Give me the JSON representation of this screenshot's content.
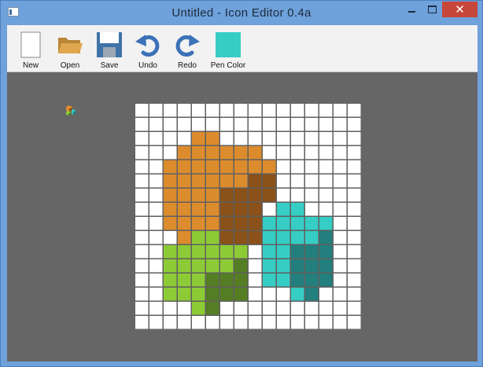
{
  "window": {
    "title": "Untitled - Icon Editor 0.4a"
  },
  "toolbar": {
    "new_label": "New",
    "open_label": "Open",
    "save_label": "Save",
    "undo_label": "Undo",
    "redo_label": "Redo",
    "pen_color_label": "Pen Color",
    "pen_color": "#36cdc4"
  },
  "caption_buttons": {
    "close_glyph": "✕"
  },
  "icons": [
    "app-icon",
    "new-file-icon",
    "folder-icon",
    "floppy-disk-icon",
    "undo-arrow-icon",
    "redo-arrow-icon",
    "color-swatch-icon",
    "icon-preview"
  ],
  "editor": {
    "grid_size": 16,
    "palette": {
      ".": "#ffffff",
      "O": "#dc8c2d",
      "B": "#8a5119",
      "C": "#36cdc4",
      "T": "#237f7e",
      "G": "#8dcb36",
      "D": "#557e24"
    },
    "pixels": [
      "................",
      "................",
      "....OO..........",
      "...OOOOOO.......",
      "..OOOOOOOO......",
      "..OOOOOOBB......",
      "..OOOOBBBB......",
      "..OOOOBBB.CC....",
      "..OOOOBBBCCCCC..",
      "...OGGBBBCCCCT..",
      "..GGGGGG.CCTTT..",
      "..GGGGGD.CCTTT..",
      "..GGGDDD.CCTTT..",
      "..GGGDDD...CT...",
      "....GD..........",
      "................"
    ]
  }
}
